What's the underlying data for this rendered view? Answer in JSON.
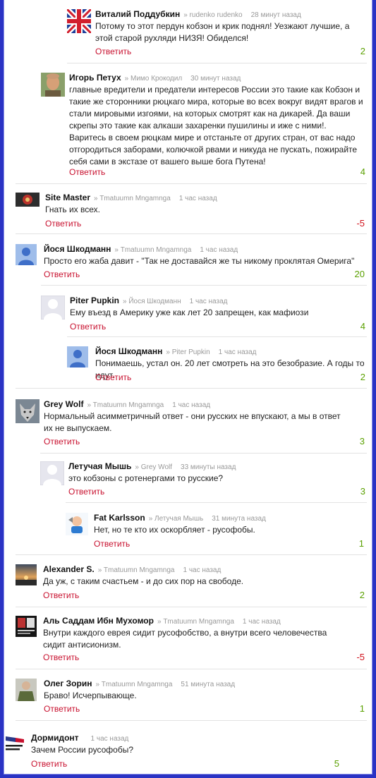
{
  "colors": {
    "frame": "#2a33c4",
    "link": "#c8102e",
    "positive": "#5aa000",
    "negative": "#d0101a",
    "meta": "#999999"
  },
  "comments": [
    {
      "author": "Виталий Поддубкин",
      "parent": "rudenko rudenko",
      "time": "28 минут назад",
      "text": "Потому то этот пердун кобзон и крик поднял! Уезжают лучшие, а этой старой рухляди НИЗЯ! Обиделся!",
      "reply": "Ответить",
      "score": "2",
      "avatar": "flag-uk-avatar"
    },
    {
      "author": "Игорь Петух",
      "parent": "Мимо Крокодил",
      "time": "30 минут назад",
      "text": "главные вредители и предатели интересов России это такие как Кобзон и такие же сторонники рюцкаго мира, которые во всех вокруг видят врагов и стали мировыми изгоями, на которых смотрят как на дикарей. Да ваши скрепы это такие как алкаши захаренки пушилины и иже с ними!. Варитесь в своем рюцкам мире и отстаньте от других стран, от вас надо отгородиться заборами, колючкой рвами и никуда не пускать, пожирайте себя сами в экстазе от вашего выше бога Путена!",
      "reply": "Ответить",
      "score": "4",
      "avatar": "photo-avatar"
    },
    {
      "author": "Site Master",
      "parent": "Tmatuumn Mngamnga",
      "time": "1 час назад",
      "text": "Гнать их всех.",
      "reply": "Ответить",
      "score": "-5",
      "avatar": "emblem-avatar"
    },
    {
      "author": "Йося Шкодманн",
      "parent": "Tmatuumn Mngamnga",
      "time": "1 час назад",
      "text": "Просто его жаба давит - \"Так не доставайся же ты никому проклятая Омерига\"",
      "reply": "Ответить",
      "score": "20",
      "avatar": "default-blue-avatar"
    },
    {
      "author": "Piter Pupkin",
      "parent": "Йося Шкодманн",
      "time": "1 час назад",
      "text": "Ему въезд в Америку уже как лет 20 запрещен, как мафиози",
      "reply": "Ответить",
      "score": "4",
      "avatar": "default-grey-avatar"
    },
    {
      "author": "Йося Шкодманн",
      "parent": "Piter Pupkin",
      "time": "1 час назад",
      "text": "Понимаешь, устал он. 20 лет смотреть на это безобразие. А годы то идут.",
      "reply": "Ответить",
      "score": "2",
      "avatar": "default-blue-avatar"
    },
    {
      "author": "Grey Wolf",
      "parent": "Tmatuumn Mngamnga",
      "time": "1 час назад",
      "text": "Нормальный асимметричный ответ - они русских не впускают, а мы в ответ их не выпускаем.",
      "reply": "Ответить",
      "score": "3",
      "avatar": "wolf-avatar"
    },
    {
      "author": "Летучая Мышь",
      "parent": "Grey Wolf",
      "time": "33 минуты назад",
      "text": "это кобзоны с ротенергами то русские?",
      "reply": "Ответить",
      "score": "3",
      "avatar": "default-grey-avatar"
    },
    {
      "author": "Fat Karlsson",
      "parent": "Летучая Мышь",
      "time": "31 минута назад",
      "text": "Нет, но те кто их оскорбляет - русофобы.",
      "reply": "Ответить",
      "score": "1",
      "avatar": "cartoon-avatar"
    },
    {
      "author": "Alexander S.",
      "parent": "Tmatuumn Mngamnga",
      "time": "1 час назад",
      "text": "Да уж, с таким счастьем - и до сих пор на свободе.",
      "reply": "Ответить",
      "score": "2",
      "avatar": "sunset-avatar"
    },
    {
      "author": "Аль Саддам Ибн Мухомор",
      "parent": "Tmatuumn Mngamnga",
      "time": "1 час назад",
      "text": "Внутри каждого еврея сидит русофобство, а внутри всего человечества сидит антисионизм.",
      "reply": "Ответить",
      "score": "-5",
      "avatar": "poster-avatar"
    },
    {
      "author": "Олег Зорин",
      "parent": "Tmatuumn Mngamnga",
      "time": "51 минута назад",
      "text": "Браво! Исчерпывающе.",
      "reply": "Ответить",
      "score": "1",
      "avatar": "soldier-avatar"
    },
    {
      "author": "Дормидонт",
      "parent": "",
      "time": "1 час назад",
      "text": "Зачем России русофобы?",
      "reply": "Ответить",
      "score": "5",
      "avatar": "sign-avatar"
    }
  ]
}
